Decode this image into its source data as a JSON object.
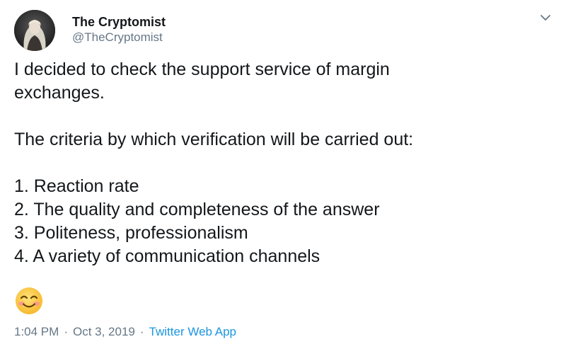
{
  "user": {
    "display_name": "The Cryptomist",
    "handle": "@TheCryptomist"
  },
  "tweet": {
    "intro_line1": "I decided to check the support service of margin",
    "intro_line2": "exchanges.",
    "criteria_intro": "The criteria by which verification will be carried out:",
    "criteria": [
      "1. Reaction rate",
      "2. The quality and completeness of the answer",
      "3. Politeness, professionalism",
      "4. A variety of communication channels"
    ],
    "emoji_icon": "smiling-face-with-smiling-eyes-icon"
  },
  "meta": {
    "time": "1:04 PM",
    "separator": "·",
    "date": "Oct 3, 2019",
    "source": "Twitter Web App"
  },
  "colors": {
    "text": "#14171a",
    "secondary": "#657786",
    "link": "#1b95e0"
  }
}
